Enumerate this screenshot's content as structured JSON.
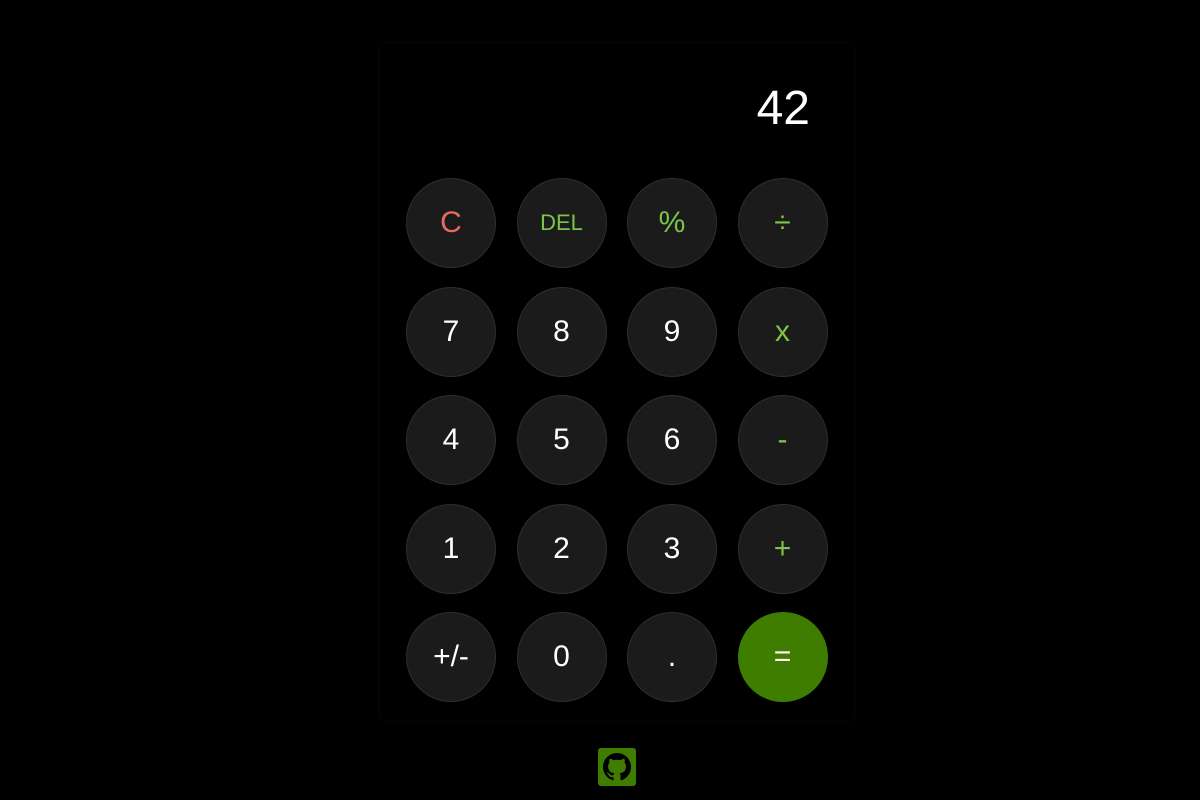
{
  "display": {
    "value": "42"
  },
  "keys": [
    {
      "label": "C",
      "name": "clear-button",
      "style": "clear"
    },
    {
      "label": "DEL",
      "name": "delete-button",
      "style": "op small"
    },
    {
      "label": "%",
      "name": "percent-button",
      "style": "op"
    },
    {
      "label": "÷",
      "name": "divide-button",
      "style": "op"
    },
    {
      "label": "7",
      "name": "digit-7-button",
      "style": ""
    },
    {
      "label": "8",
      "name": "digit-8-button",
      "style": ""
    },
    {
      "label": "9",
      "name": "digit-9-button",
      "style": ""
    },
    {
      "label": "x",
      "name": "multiply-button",
      "style": "op"
    },
    {
      "label": "4",
      "name": "digit-4-button",
      "style": ""
    },
    {
      "label": "5",
      "name": "digit-5-button",
      "style": ""
    },
    {
      "label": "6",
      "name": "digit-6-button",
      "style": ""
    },
    {
      "label": "-",
      "name": "subtract-button",
      "style": "op"
    },
    {
      "label": "1",
      "name": "digit-1-button",
      "style": ""
    },
    {
      "label": "2",
      "name": "digit-2-button",
      "style": ""
    },
    {
      "label": "3",
      "name": "digit-3-button",
      "style": ""
    },
    {
      "label": "+",
      "name": "add-button",
      "style": "op"
    },
    {
      "label": "+/-",
      "name": "toggle-sign-button",
      "style": ""
    },
    {
      "label": "0",
      "name": "digit-0-button",
      "style": ""
    },
    {
      "label": ".",
      "name": "decimal-button",
      "style": ""
    },
    {
      "label": "=",
      "name": "equals-button",
      "style": "equals"
    }
  ],
  "footer": {
    "icon": "github-icon"
  },
  "colors": {
    "background": "#000000",
    "key": "#1b1b1b",
    "operator_text": "#7cc44a",
    "clear_text": "#e86a63",
    "accent": "#3f7d00"
  }
}
